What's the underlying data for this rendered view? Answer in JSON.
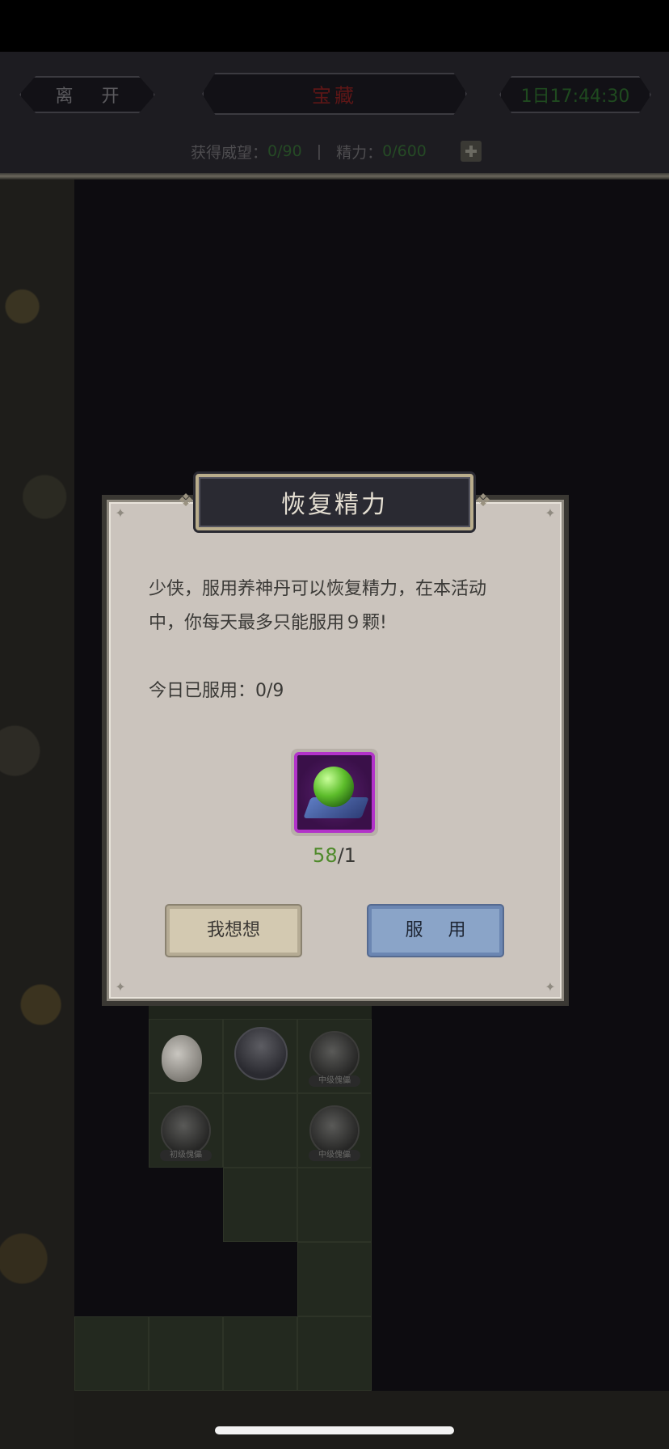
{
  "hud": {
    "leave_label": "离 开",
    "title": "宝藏",
    "timer": "1日17:44:30",
    "prestige_label": "获得威望：",
    "prestige_value": "0/90",
    "separator": "|",
    "energy_label": "精力：",
    "energy_value": "0/600"
  },
  "map": {
    "token_labels": [
      "中级傀儡",
      "初级傀儡",
      "中级傀儡"
    ]
  },
  "dialog": {
    "title": "恢复精力",
    "message": "少侠，服用养神丹可以恢复精力，在本活动中，你每天最多只能服用９颗!",
    "used_today_label": "今日已服用：",
    "used_today_value": "0/9",
    "item_owned": "58",
    "item_required": "/1",
    "cancel_label": "我想想",
    "confirm_label": "服 用"
  },
  "colors": {
    "owned_count": "#4f8a2b",
    "item_rarity_border": "#b233c9",
    "confirm_button": "#8aa4c8",
    "cancel_button": "#d3c9b1"
  }
}
